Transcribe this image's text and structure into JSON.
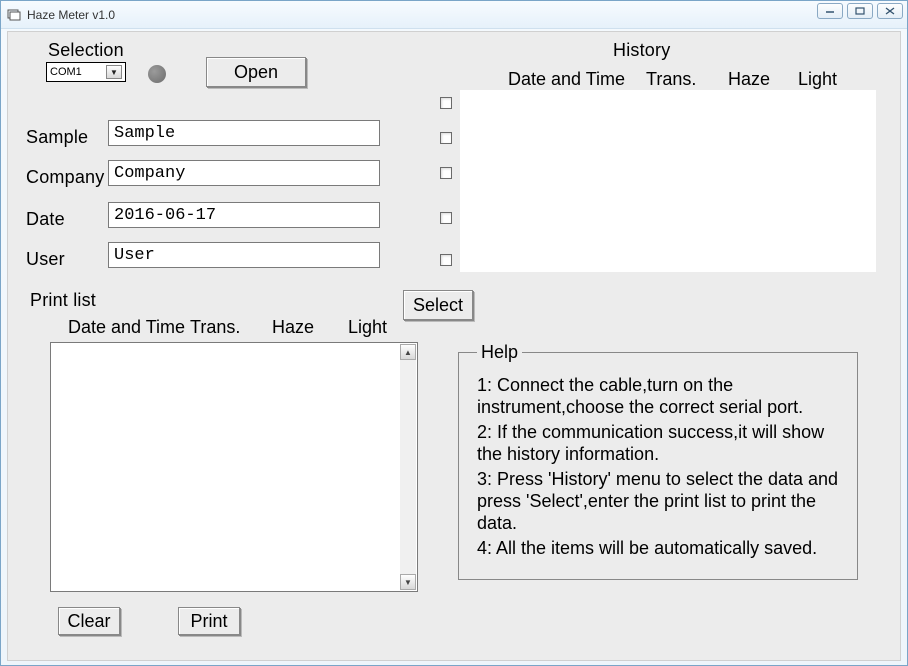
{
  "window": {
    "title": "Haze Meter v1.0"
  },
  "selection": {
    "label": "Selection",
    "port": "COM1",
    "open_btn": "Open"
  },
  "fields": {
    "sample_label": "Sample",
    "sample_value": "Sample",
    "company_label": "Company",
    "company_value": "Company",
    "date_label": "Date",
    "date_value": "2016-06-17",
    "user_label": "User",
    "user_value": "User"
  },
  "history": {
    "title": "History",
    "col_datetime": "Date and Time",
    "col_trans": "Trans.",
    "col_haze": "Haze",
    "col_light": "Light",
    "select_btn": "Select"
  },
  "printlist": {
    "title": "Print list",
    "col_datetime": "Date and Time",
    "col_trans": "Trans.",
    "col_haze": "Haze",
    "col_light": "Light",
    "clear_btn": "Clear",
    "print_btn": "Print"
  },
  "help": {
    "legend": "Help",
    "l1": "1: Connect the cable,turn on the instrument,choose the correct serial port.",
    "l2": "2: If the communication success,it will show the history information.",
    "l3": "3: Press 'History' menu to select the data and press 'Select',enter the print list to print the data.",
    "l4": "4: All the items will be automatically saved."
  }
}
